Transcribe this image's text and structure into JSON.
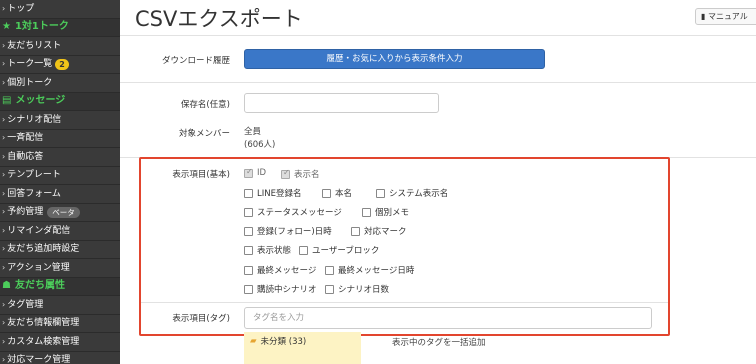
{
  "sidebar": {
    "items": [
      {
        "type": "item",
        "label": "トップ"
      },
      {
        "type": "section",
        "label": "1対1トーク",
        "icon": "star-icon"
      },
      {
        "type": "item",
        "label": "友だちリスト"
      },
      {
        "type": "item",
        "label": "トーク一覧",
        "badge": "2"
      },
      {
        "type": "item",
        "label": "個別トーク"
      },
      {
        "type": "section",
        "label": "メッセージ",
        "icon": "chat-icon"
      },
      {
        "type": "item",
        "label": "シナリオ配信"
      },
      {
        "type": "item",
        "label": "一斉配信"
      },
      {
        "type": "item",
        "label": "自動応答"
      },
      {
        "type": "item",
        "label": "テンプレート"
      },
      {
        "type": "item",
        "label": "回答フォーム"
      },
      {
        "type": "item",
        "label": "予約管理",
        "tag": "ベータ"
      },
      {
        "type": "item",
        "label": "リマインダ配信"
      },
      {
        "type": "item",
        "label": "友だち追加時設定"
      },
      {
        "type": "item",
        "label": "アクション管理"
      },
      {
        "type": "section",
        "label": "友だち属性",
        "icon": "people-icon"
      },
      {
        "type": "item",
        "label": "タグ管理"
      },
      {
        "type": "item",
        "label": "友だち情報欄管理"
      },
      {
        "type": "item",
        "label": "カスタム検索管理"
      },
      {
        "type": "item",
        "label": "対応マーク管理"
      }
    ]
  },
  "header": {
    "title": "CSVエクスポート",
    "manual_label": "マニュアル"
  },
  "form": {
    "download_history_label": "ダウンロード履歴",
    "download_history_button": "履歴・お気に入りから表示条件入力",
    "save_name_label": "保存名(任意)",
    "save_name_value": "",
    "target_label": "対象メンバー",
    "target_line1": "全員",
    "target_line2": "(606人)",
    "display_basic_label": "表示項目(基本)",
    "display_tag_label": "表示項目(タグ)",
    "tag_input_placeholder": "タグ名を入力"
  },
  "checkboxes": [
    {
      "label": "ID",
      "checked": true
    },
    {
      "label": "表示名",
      "checked": true
    },
    {
      "label": "LINE登録名",
      "checked": false
    },
    {
      "label": "本名",
      "checked": false
    },
    {
      "label": "システム表示名",
      "checked": false
    },
    {
      "label": "ステータスメッセージ",
      "checked": false
    },
    {
      "label": "個別メモ",
      "checked": false
    },
    {
      "label": "登録(フォロー)日時",
      "checked": false
    },
    {
      "label": "対応マーク",
      "checked": false
    },
    {
      "label": "表示状態",
      "checked": false
    },
    {
      "label": "ユーザーブロック",
      "checked": false
    },
    {
      "label": "最終メッセージ",
      "checked": false
    },
    {
      "label": "最終メッセージ日時",
      "checked": false
    },
    {
      "label": "購読中シナリオ",
      "checked": false
    },
    {
      "label": "シナリオ日数",
      "checked": false
    }
  ],
  "tag_list": {
    "folder_label": "未分類 (33)",
    "add_all_note": "表示中のタグを一括追加"
  },
  "colors": {
    "accent_green": "#4ccd5b",
    "button_blue": "#3a77c8",
    "highlight_red": "#e2452e",
    "sidebar_bg": "#3a3a3a"
  }
}
